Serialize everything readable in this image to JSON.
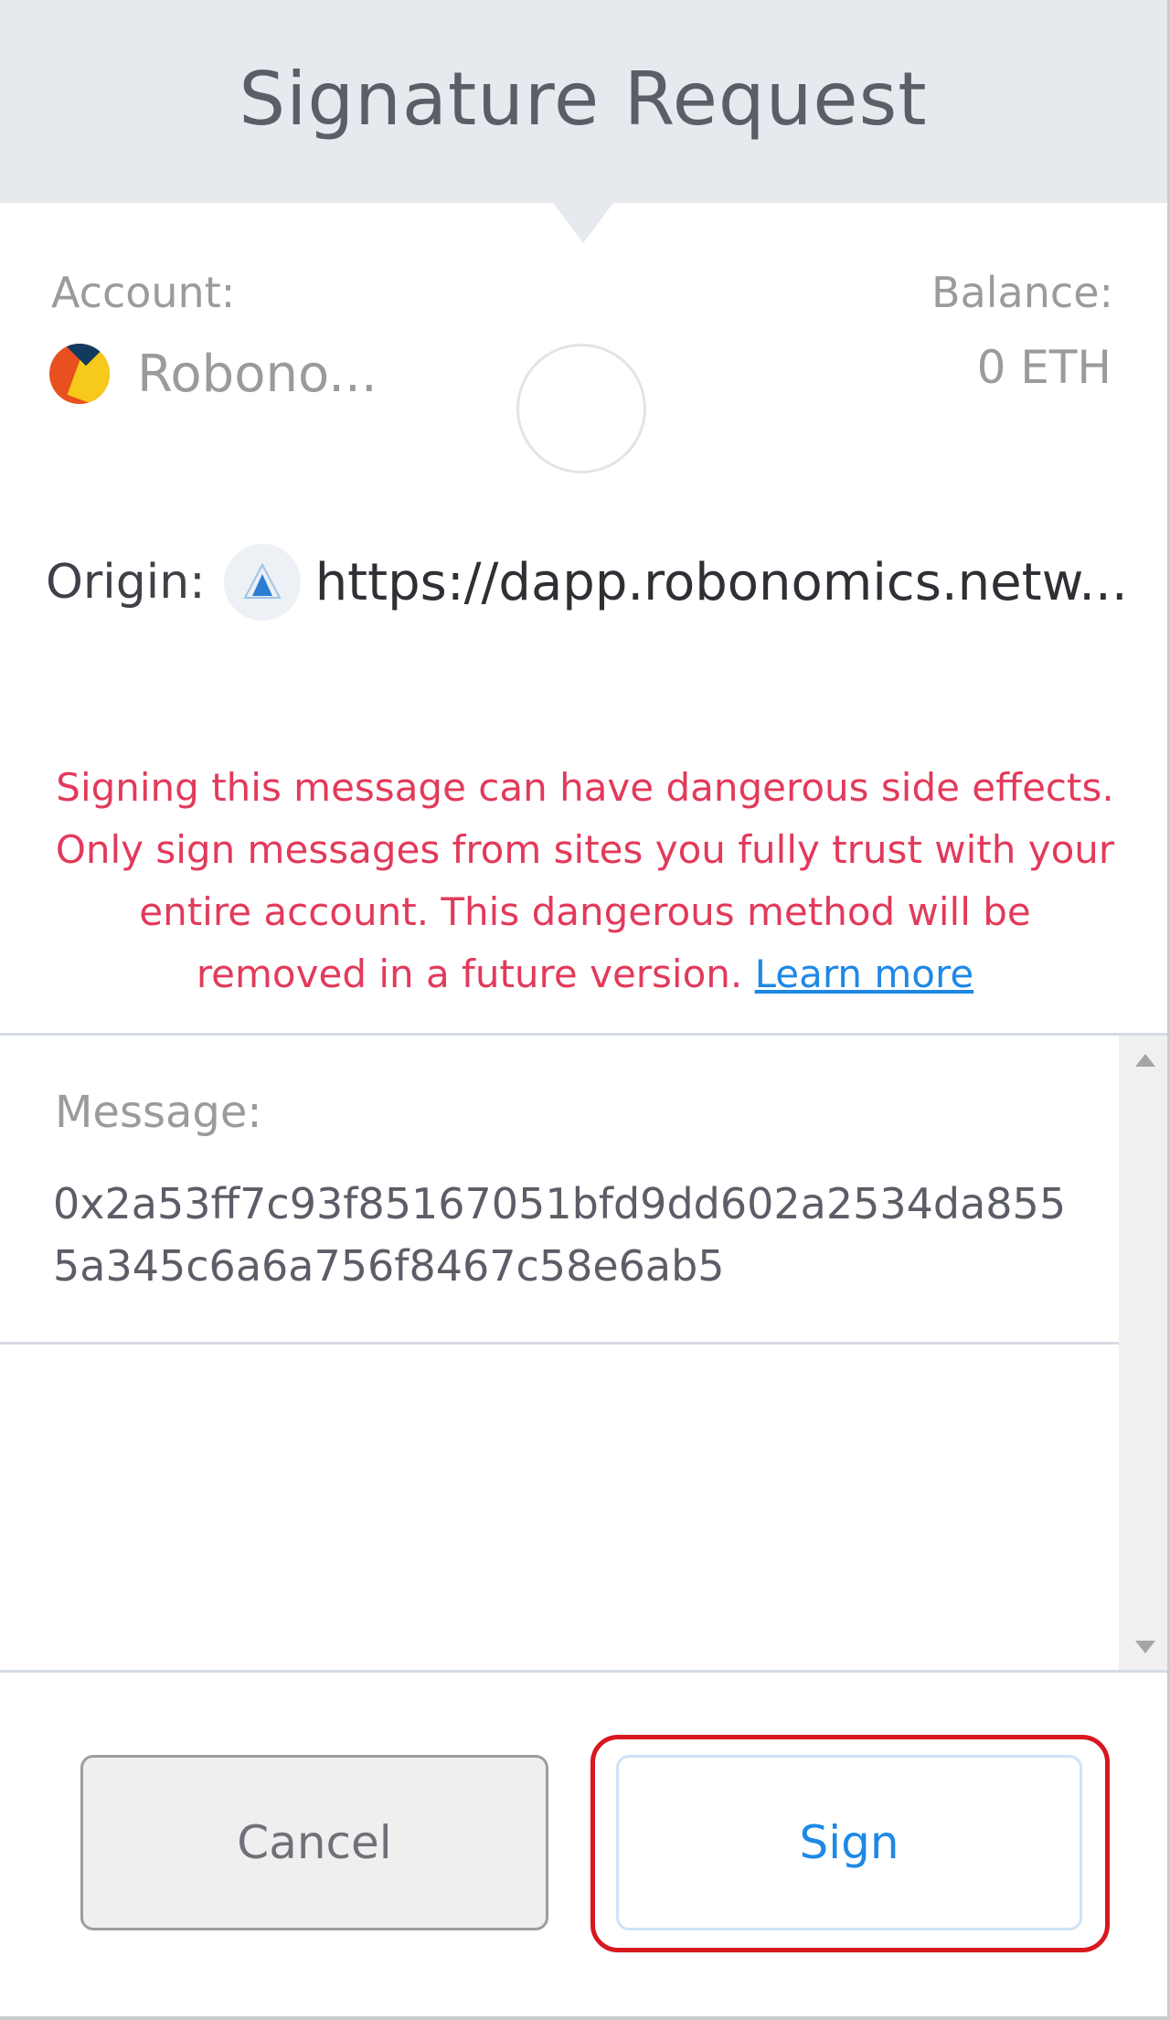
{
  "header": {
    "title": "Signature Request"
  },
  "account": {
    "label": "Account:",
    "name": "Robono..."
  },
  "balance": {
    "label": "Balance:",
    "value": "0 ETH"
  },
  "origin": {
    "label": "Origin:",
    "url": "https://dapp.robonomics.netw..."
  },
  "warning": {
    "line1": "Signing this message can have dangerous side effects.",
    "line2": "Only sign messages from sites you fully trust with your",
    "line3": "entire account. This dangerous method will be",
    "line4_prefix": "removed in a future version. ",
    "link_text": "Learn more"
  },
  "message": {
    "label": "Message:",
    "line1": "0x2a53ff7c93f85167051bfd9dd602a2534da855",
    "line2": "5a345c6a6a756f8467c58e6ab5"
  },
  "buttons": {
    "cancel": "Cancel",
    "sign": "Sign"
  },
  "colors": {
    "warning": "#e23a5b",
    "link": "#1e88e5",
    "highlight": "#d7191f"
  },
  "icons": [
    "account-identicon",
    "site-logo-icon",
    "scroll-up-icon",
    "scroll-down-icon"
  ]
}
